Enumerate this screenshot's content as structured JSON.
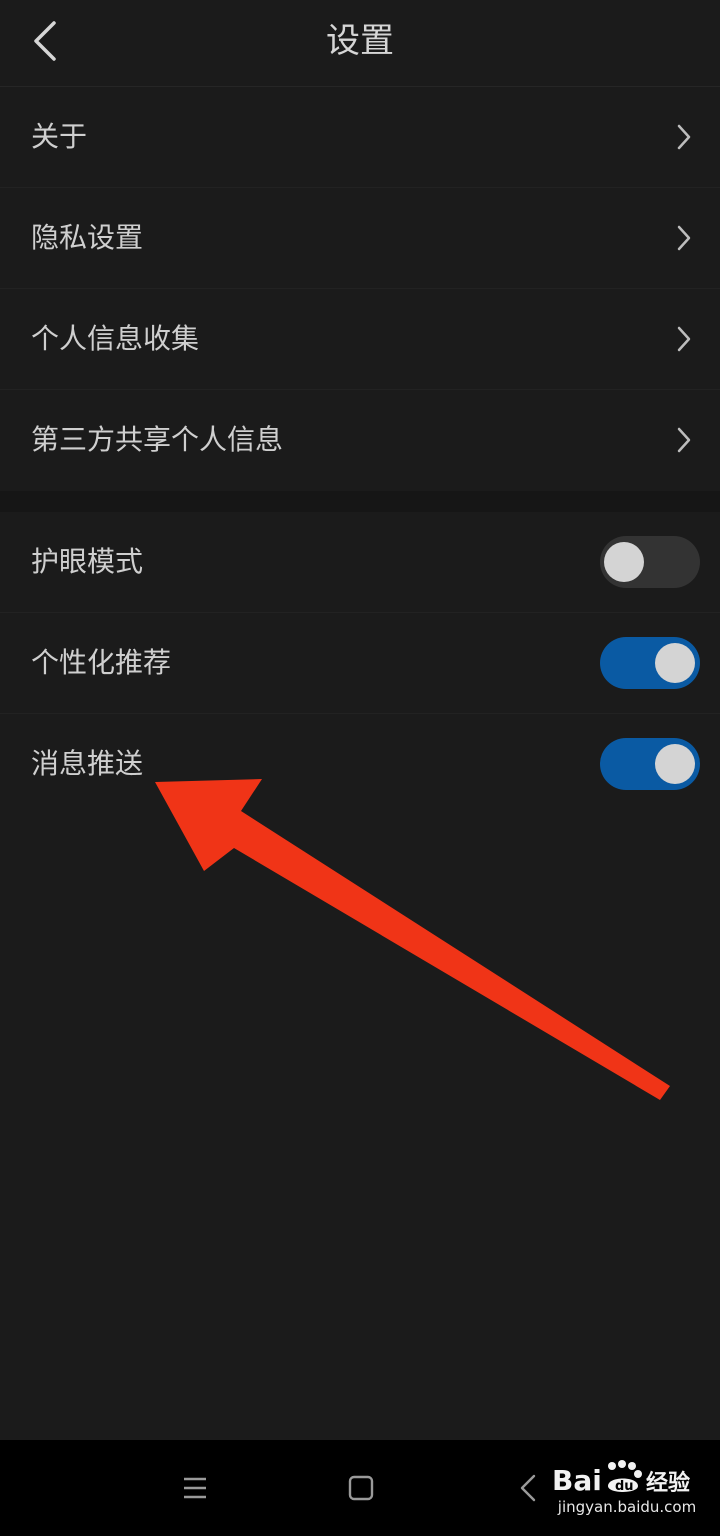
{
  "header": {
    "title": "设置",
    "back_icon": "chevron-left-icon"
  },
  "nav_items": [
    {
      "label": "关于"
    },
    {
      "label": "隐私设置"
    },
    {
      "label": "个人信息收集"
    },
    {
      "label": "第三方共享个人信息"
    }
  ],
  "toggle_items": [
    {
      "label": "护眼模式",
      "state": "off"
    },
    {
      "label": "个性化推荐",
      "state": "on"
    },
    {
      "label": "消息推送",
      "state": "on"
    }
  ],
  "colors": {
    "background": "#1b1b1b",
    "toggle_on": "#0a5aa3",
    "toggle_off": "#333333",
    "annotation_arrow": "#f03417"
  },
  "system_nav": {
    "menu_icon": "menu-icon",
    "home_icon": "home-square-icon",
    "back_icon": "back-triangle-icon"
  },
  "watermark": {
    "logo_text": "Bai du 经验",
    "url": "jingyan.baidu.com"
  }
}
